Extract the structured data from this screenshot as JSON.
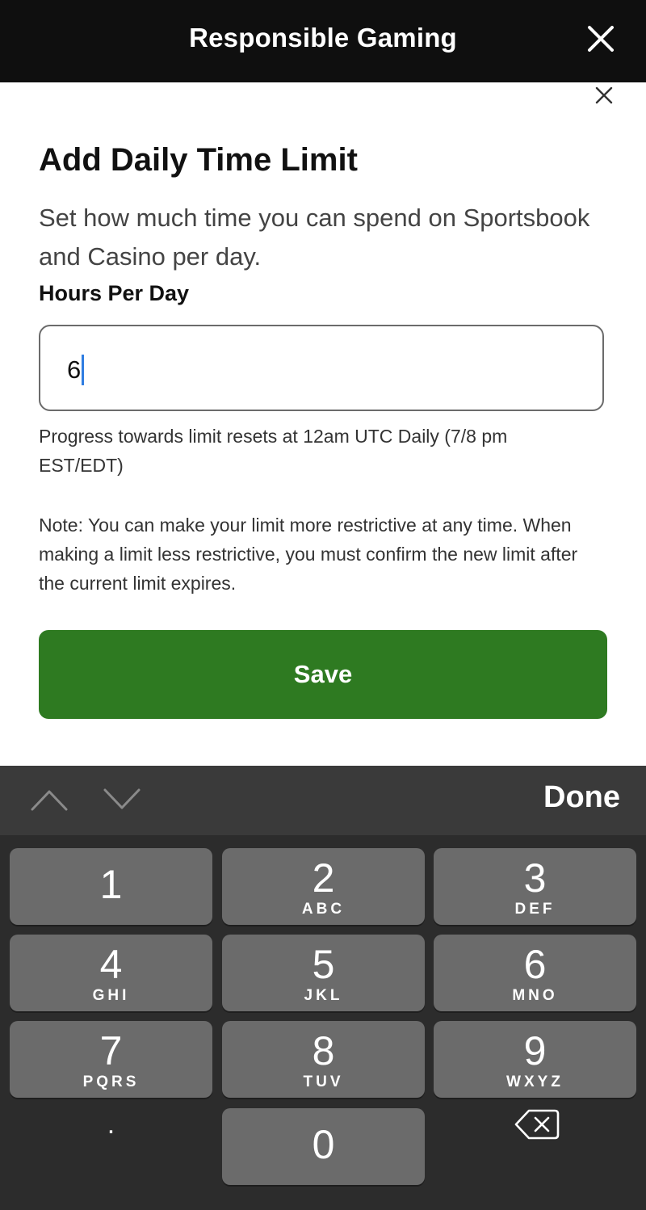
{
  "header": {
    "title": "Responsible Gaming"
  },
  "sheet": {
    "title": "Add Daily Time Limit",
    "description": "Set how much time you can spend on Sportsbook and Casino per day.",
    "field_label": "Hours Per Day",
    "hours_value": "6",
    "reset_info": "Progress towards limit resets at 12am UTC Daily (7/8 pm EST/EDT)",
    "note": "Note: You can make your limit more restrictive at any time. When making a limit less restrictive, you must confirm the new limit after the current limit expires.",
    "save_label": "Save"
  },
  "accessory": {
    "done_label": "Done"
  },
  "keyboard": {
    "keys": [
      {
        "digit": "1",
        "letters": ""
      },
      {
        "digit": "2",
        "letters": "ABC"
      },
      {
        "digit": "3",
        "letters": "DEF"
      },
      {
        "digit": "4",
        "letters": "GHI"
      },
      {
        "digit": "5",
        "letters": "JKL"
      },
      {
        "digit": "6",
        "letters": "MNO"
      },
      {
        "digit": "7",
        "letters": "PQRS"
      },
      {
        "digit": "8",
        "letters": "TUV"
      },
      {
        "digit": "9",
        "letters": "WXYZ"
      },
      {
        "digit": "0",
        "letters": ""
      }
    ],
    "decimal_label": "."
  },
  "colors": {
    "header_bg": "#0f0f0f",
    "save_button": "#2e7a21",
    "caret": "#2f7de1",
    "keyboard_bg": "#2c2c2c",
    "key_bg": "#6b6b6b"
  }
}
